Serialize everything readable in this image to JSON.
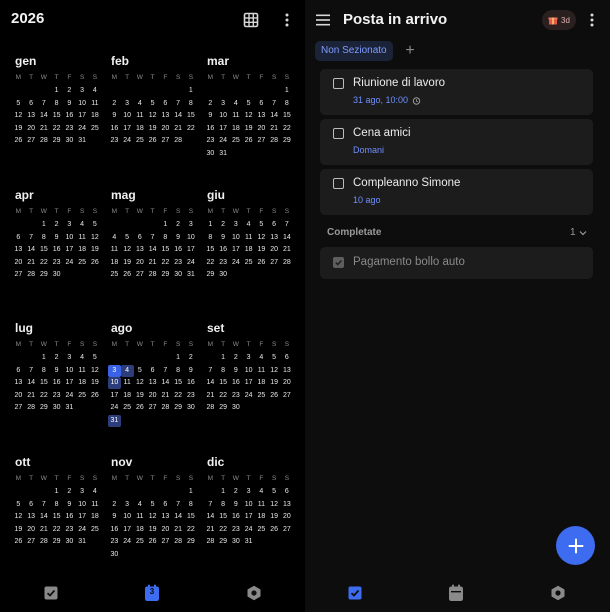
{
  "calendar": {
    "year": "2026",
    "weekdays": [
      "M",
      "T",
      "W",
      "T",
      "F",
      "S",
      "S"
    ],
    "months": [
      {
        "name": "gen",
        "offset": 3,
        "days": 31
      },
      {
        "name": "feb",
        "offset": 6,
        "days": 28
      },
      {
        "name": "mar",
        "offset": 6,
        "days": 31
      },
      {
        "name": "apr",
        "offset": 2,
        "days": 30
      },
      {
        "name": "mag",
        "offset": 4,
        "days": 31
      },
      {
        "name": "giu",
        "offset": 0,
        "days": 30
      },
      {
        "name": "lug",
        "offset": 2,
        "days": 31
      },
      {
        "name": "ago",
        "offset": 5,
        "days": 31
      },
      {
        "name": "set",
        "offset": 1,
        "days": 30
      },
      {
        "name": "ott",
        "offset": 3,
        "days": 31
      },
      {
        "name": "nov",
        "offset": 6,
        "days": 30
      },
      {
        "name": "dic",
        "offset": 1,
        "days": 31
      }
    ],
    "today": {
      "month": 7,
      "day": 3
    },
    "selected": {
      "month": 7,
      "days": [
        4,
        10,
        31
      ]
    }
  },
  "left_nav": {
    "items": [
      {
        "name": "tasks-nav",
        "icon": "checkbox-icon"
      },
      {
        "name": "calendar-nav",
        "icon": "calendar-icon",
        "label": "3",
        "active": true
      },
      {
        "name": "habits-nav",
        "icon": "hexagon-icon"
      }
    ]
  },
  "inbox": {
    "title": "Posta in arrivo",
    "badge": "3d",
    "tab": "Non Sezionato",
    "tasks": [
      {
        "title": "Riunione di lavoro",
        "sub": "31 ago, 10:00",
        "alarm": true
      },
      {
        "title": "Cena amici",
        "sub": "Domani",
        "alarm": false
      },
      {
        "title": "Compleanno Simone",
        "sub": "10 ago",
        "alarm": false
      }
    ],
    "completed_label": "Completate",
    "completed_count": "1",
    "completed_tasks": [
      {
        "title": "Pagamento bollo auto"
      }
    ]
  },
  "colors": {
    "accent": "#3d6cf0",
    "link": "#6f8fff",
    "card": "#1c1c1c"
  }
}
